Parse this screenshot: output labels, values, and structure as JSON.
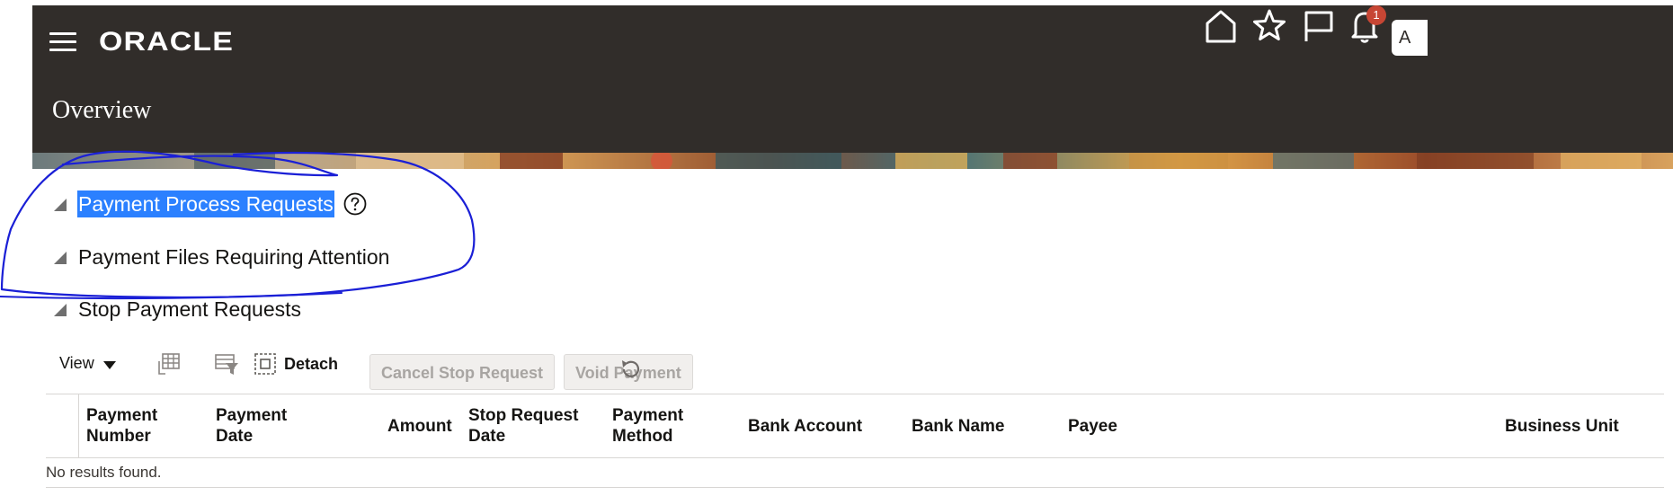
{
  "header": {
    "logo_text": "ORACLE",
    "page_title": "Overview",
    "notifications_count": "1",
    "user_initial": "A",
    "icons": [
      "hamburger-menu-icon",
      "home-icon",
      "favorites-star-icon",
      "flag-icon",
      "bell-icon"
    ]
  },
  "sections": [
    {
      "label": "Payment Process Requests",
      "selected": true,
      "help": true
    },
    {
      "label": "Payment Files Requiring Attention",
      "selected": false,
      "help": false
    },
    {
      "label": "Stop Payment Requests",
      "selected": false,
      "help": false
    }
  ],
  "toolbar": {
    "view_label": "View",
    "detach_label": "Detach",
    "cancel_stop_request_label": "Cancel Stop Request",
    "void_payment_label": "Void Payment",
    "icons": [
      "freeze-column-icon",
      "query-by-example-icon",
      "detach-icon",
      "refresh-icon"
    ]
  },
  "table": {
    "columns": [
      "Payment\nNumber",
      "Payment\nDate",
      "Amount",
      "Stop Request\nDate",
      "Payment\nMethod",
      "Bank Account",
      "Bank Name",
      "Payee",
      "Business Unit"
    ],
    "empty_message": "No results found."
  },
  "colors": {
    "header_bg": "#312d2a",
    "selection": "#2b80ff",
    "badge": "#c74634",
    "annotation_ink": "#1a1fd6"
  }
}
